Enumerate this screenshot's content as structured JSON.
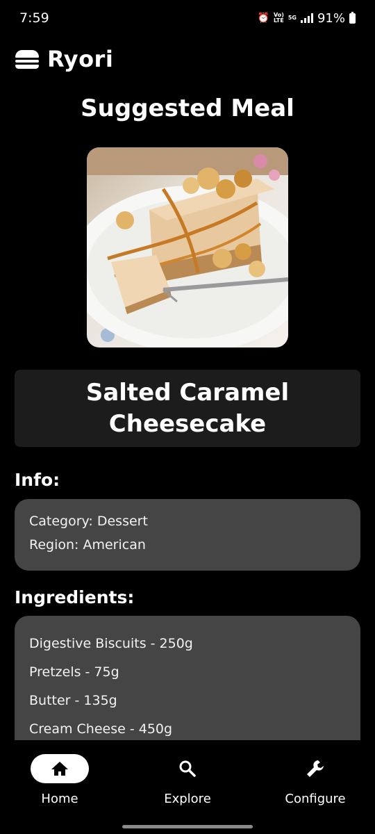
{
  "status_bar": {
    "time": "7:59",
    "battery_percent": "91%",
    "volte_label": "Vo)",
    "lte_label": "LTE",
    "network_label": "5G"
  },
  "app": {
    "title": "Ryori"
  },
  "page": {
    "title": "Suggested Meal"
  },
  "meal": {
    "name": "Salted Caramel Cheesecake",
    "info_heading": "Info:",
    "category": "Category: Dessert",
    "region": "Region: American",
    "ingredients_heading": "Ingredients:",
    "ingredients": [
      "Digestive Biscuits - 250g",
      "Pretzels - 75g",
      "Butter - 135g",
      "Cream Cheese - 450g"
    ]
  },
  "nav": {
    "home": "Home",
    "explore": "Explore",
    "configure": "Configure"
  },
  "colors": {
    "background": "#000000",
    "card": "#454545",
    "title_card": "#1c1c1c",
    "active_pill": "#ffffff"
  }
}
